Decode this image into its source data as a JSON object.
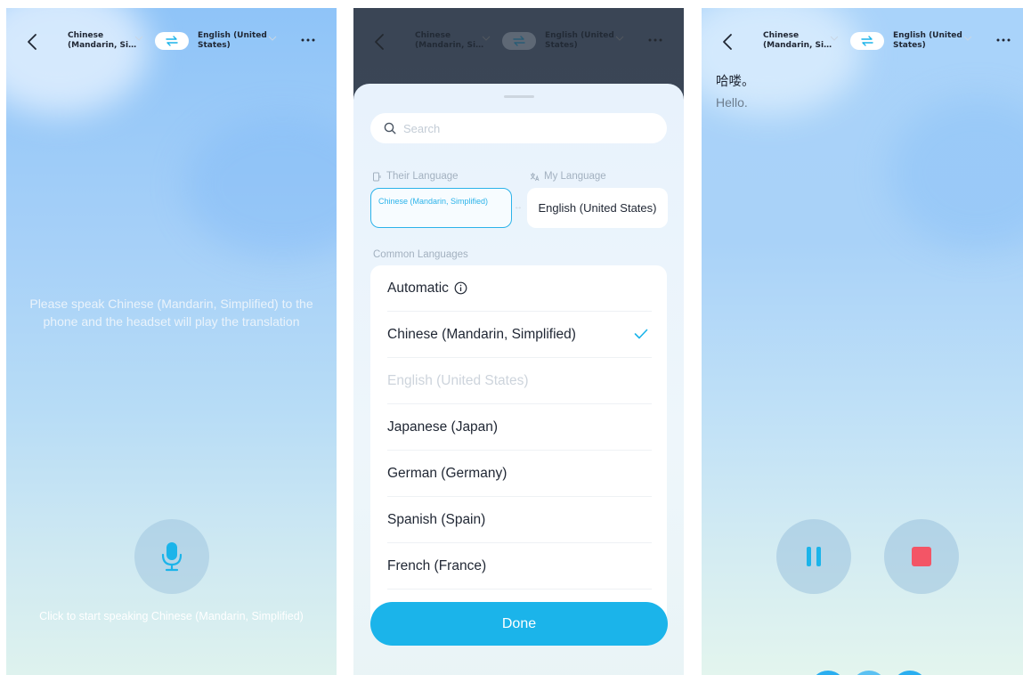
{
  "header": {
    "source_lang": "Chinese (Mandarin, Si…",
    "source_lang_line1": "Chinese",
    "source_lang_line2": "(Mandarin, Si…",
    "target_lang_line1": "English (United",
    "target_lang_line2": "States)"
  },
  "screen1": {
    "prompt": "Please speak Chinese (Mandarin, Simplified) to the phone and the headset will play the translation",
    "hint": "Click to start speaking Chinese (Mandarin, Simplified)"
  },
  "screen2": {
    "search_placeholder": "Search",
    "their_language_label": "Their Language",
    "my_language_label": "My Language",
    "their_language_value": "Chinese (Mandarin, Simplified)",
    "my_language_value": "English (United States)",
    "common_languages_label": "Common Languages",
    "languages": [
      {
        "label": "Automatic",
        "state": "info"
      },
      {
        "label": "Chinese (Mandarin, Simplified)",
        "state": "selected"
      },
      {
        "label": "English (United States)",
        "state": "disabled"
      },
      {
        "label": "Japanese (Japan)",
        "state": "normal"
      },
      {
        "label": "German (Germany)",
        "state": "normal"
      },
      {
        "label": "Spanish (Spain)",
        "state": "normal"
      },
      {
        "label": "French (France)",
        "state": "normal"
      }
    ],
    "done_label": "Done"
  },
  "screen3": {
    "source_text": "哈喽。",
    "translated_text": "Hello."
  },
  "colors": {
    "accent": "#1bb4ea",
    "stop": "#f35566",
    "text_dark": "#1f2633"
  }
}
